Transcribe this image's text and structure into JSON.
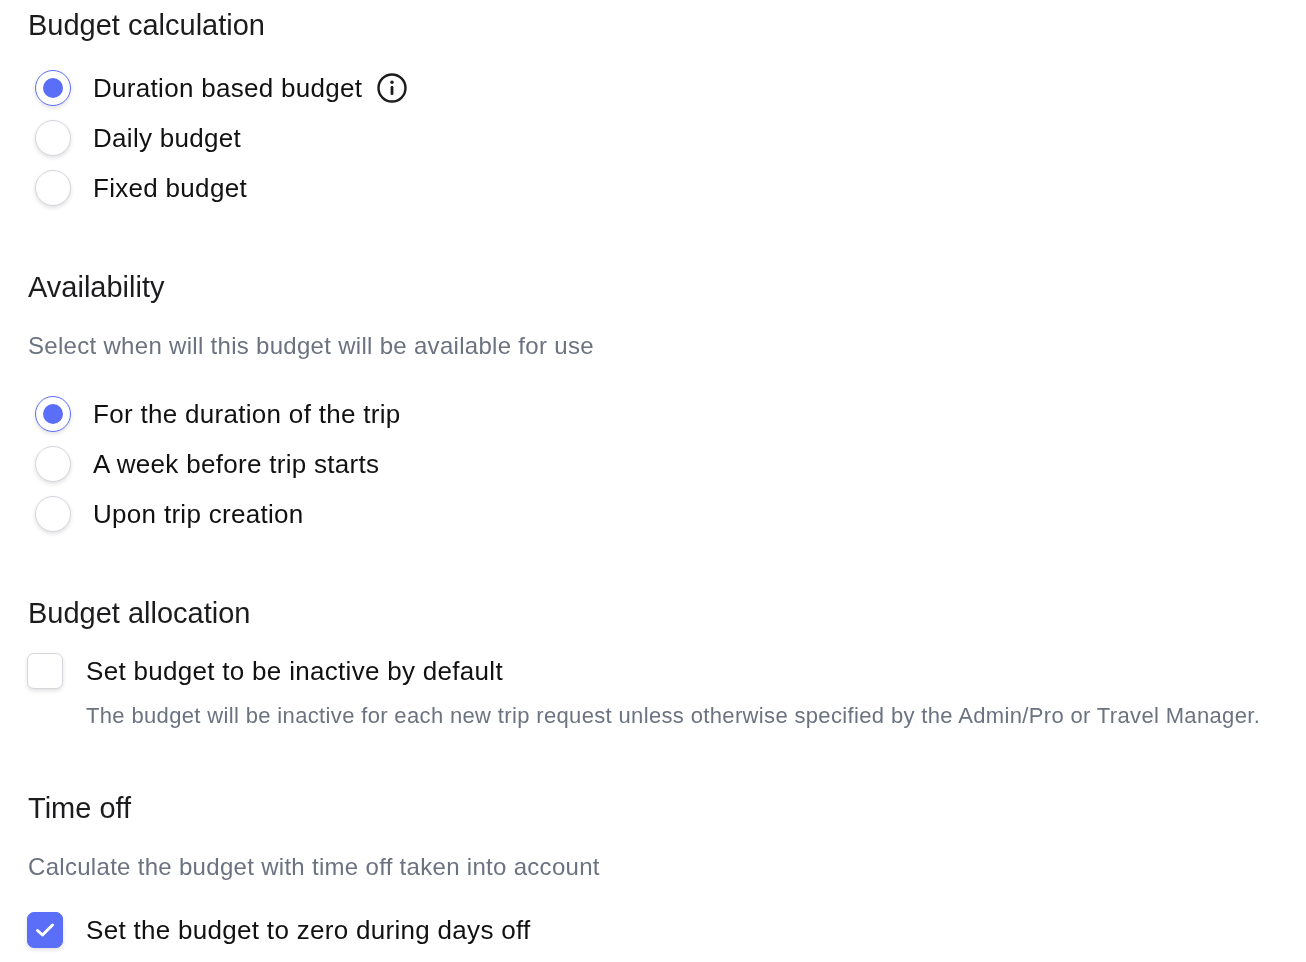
{
  "sections": [
    {
      "kind": "radio",
      "title": "Budget calculation",
      "options": [
        {
          "label": "Duration based budget",
          "selected": true,
          "info": true
        },
        {
          "label": "Daily budget",
          "selected": false,
          "info": false
        },
        {
          "label": "Fixed budget",
          "selected": false,
          "info": false
        }
      ]
    },
    {
      "kind": "radio",
      "title": "Availability",
      "description": "Select when will this budget will be available for use",
      "options": [
        {
          "label": "For the duration of the trip",
          "selected": true,
          "info": false
        },
        {
          "label": "A week before trip starts",
          "selected": false,
          "info": false
        },
        {
          "label": "Upon trip creation",
          "selected": false,
          "info": false
        }
      ]
    },
    {
      "kind": "checkbox",
      "title": "Budget allocation",
      "options": [
        {
          "label": "Set budget to be inactive by default",
          "checked": false,
          "description": "The budget will be inactive for each new trip request unless otherwise specified by the Admin/Pro or Travel Manager."
        }
      ]
    },
    {
      "kind": "checkbox",
      "title": "Time off",
      "description": "Calculate the budget with time off taken into account",
      "options": [
        {
          "label": "Set the budget to zero during days off",
          "checked": true
        }
      ]
    }
  ]
}
